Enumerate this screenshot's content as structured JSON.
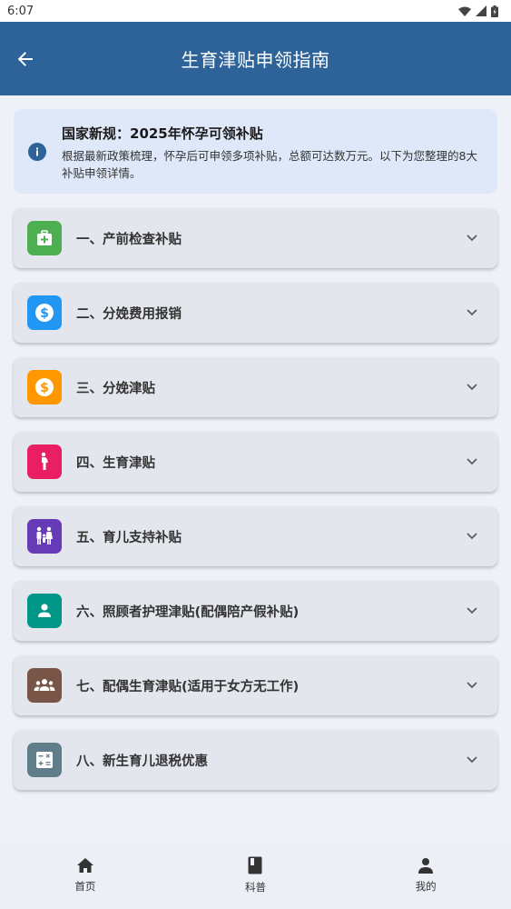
{
  "status_bar": {
    "time": "6:07"
  },
  "app_bar": {
    "title": "生育津贴申领指南"
  },
  "notice": {
    "title": "国家新规：2025年怀孕可领补贴",
    "body": "根据最新政策梳理，怀孕后可申领多项补贴，总额可达数万元。以下为您整理的8大补贴申领详情。"
  },
  "items": [
    {
      "label": "一、产前检查补贴",
      "icon": "medical-bag-icon",
      "color": "#4caf50"
    },
    {
      "label": "二、分娩费用报销",
      "icon": "dollar-circle-icon",
      "color": "#2196f3"
    },
    {
      "label": "三、分娩津贴",
      "icon": "dollar-circle-icon",
      "color": "#ff9800"
    },
    {
      "label": "四、生育津贴",
      "icon": "pregnant-woman-icon",
      "color": "#e91e63"
    },
    {
      "label": "五、育儿支持补贴",
      "icon": "family-icon",
      "color": "#673ab7"
    },
    {
      "label": "六、照顾者护理津贴(配偶陪产假补贴)",
      "icon": "person-icon",
      "color": "#009688"
    },
    {
      "label": "七、配偶生育津贴(适用于女方无工作)",
      "icon": "group-icon",
      "color": "#795548"
    },
    {
      "label": "八、新生育儿退税优惠",
      "icon": "calculator-icon",
      "color": "#607d8b"
    }
  ],
  "bottom_nav": [
    {
      "label": "首页",
      "icon": "home-icon"
    },
    {
      "label": "科普",
      "icon": "book-icon"
    },
    {
      "label": "我的",
      "icon": "person-icon"
    }
  ],
  "colors": {
    "primary": "#2e6399",
    "background": "#eef1f7",
    "notice_bg": "#dfe8f8"
  }
}
